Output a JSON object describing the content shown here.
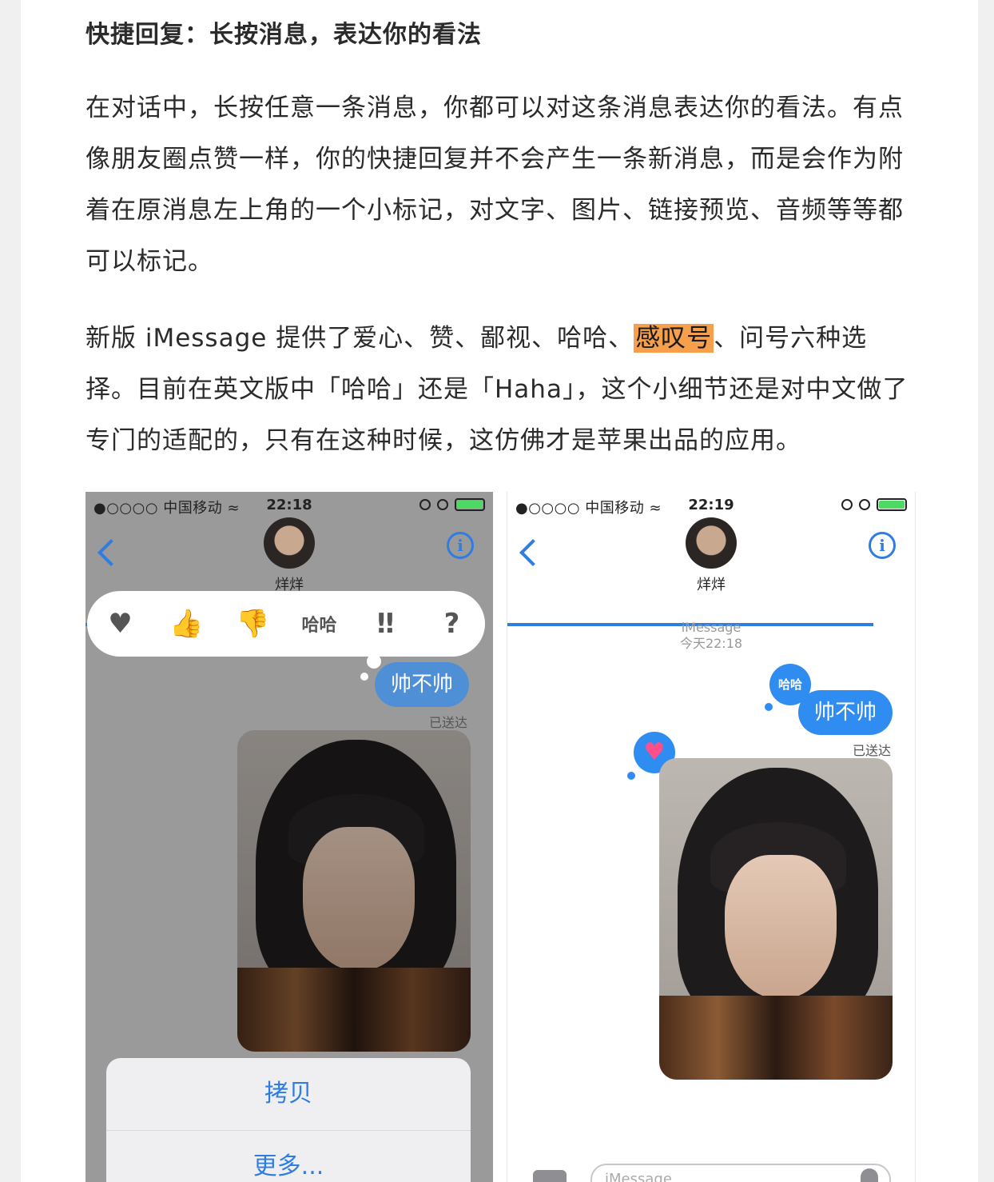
{
  "article": {
    "heading": "快捷回复：长按消息，表达你的看法",
    "para1": "在对话中，长按任意一条消息，你都可以对这条消息表达你的看法。有点像朋友圈点赞一样，你的快捷回复并不会产生一条新消息，而是会作为附着在原消息左上角的一个小标记，对文字、图片、链接预览、音频等等都可以标记。",
    "para2_before": "新版 iMessage 提供了爱心、赞、鄙视、哈哈、",
    "para2_highlight": "感叹号",
    "para2_after": "、问号六种选择。目前在英文版中「哈哈」还是「Haha」，这个小细节还是对中文做了专门的适配的，只有在这种时候，这仿佛才是苹果出品的应用。",
    "highlight_color": "#f6a04d"
  },
  "left_phone": {
    "carrier": "●○○○○ 中国移动 ≈",
    "time": "22:18",
    "contact_name": "烊烊",
    "tapbacks": [
      "♥",
      "👍",
      "👎",
      "哈哈",
      "‼",
      "?"
    ],
    "bubble_text": "帅不帅",
    "delivered": "已送达",
    "actions": [
      "拷贝",
      "更多..."
    ]
  },
  "right_phone": {
    "carrier": "●○○○○ 中国移动 ≈",
    "time": "22:19",
    "contact_name": "烊烊",
    "service": "iMessage",
    "timestamp": "今天22:18",
    "haha_badge": "哈哈",
    "heart_badge": "♥",
    "bubble_text": "帅不帅",
    "delivered": "已送达",
    "input_placeholder": "iMessage"
  },
  "colors": {
    "ios_blue": "#2f7de1",
    "bubble_blue": "#2f8cf0"
  }
}
